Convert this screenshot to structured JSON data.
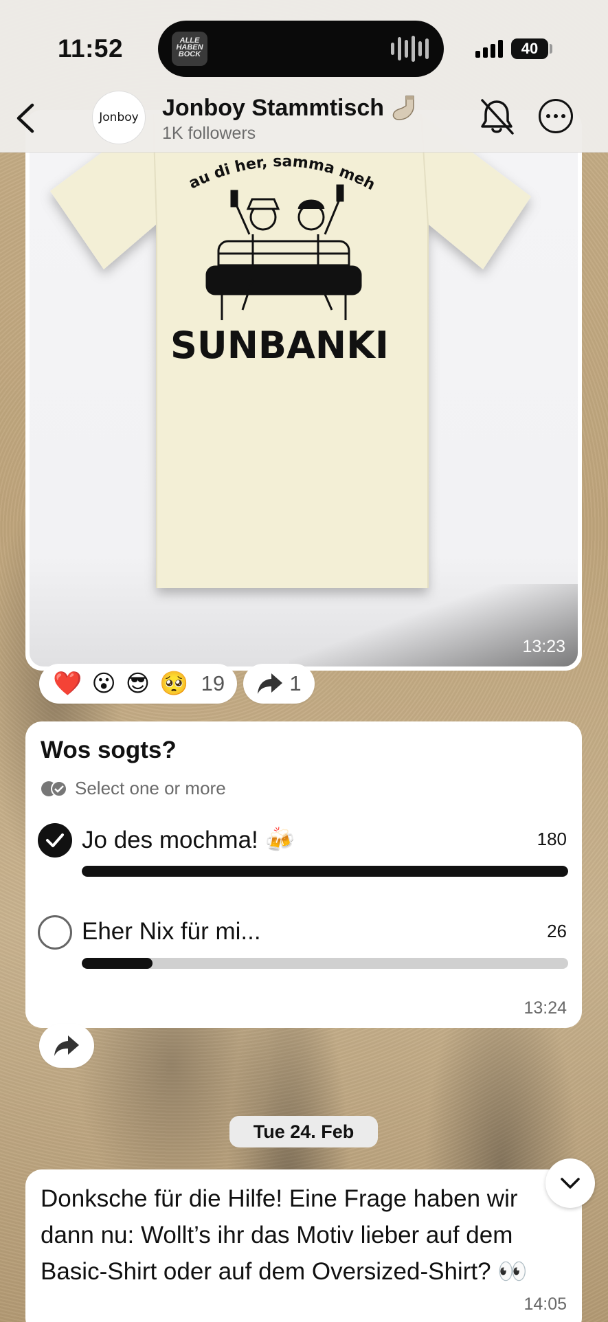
{
  "status_bar": {
    "time": "11:52",
    "island_art_text": "ALLE HABEN BOCK",
    "battery": "40"
  },
  "header": {
    "avatar_text": "Jonboy",
    "title": "Jonboy Stammtisch",
    "followers": "1K followers",
    "title_icon": "sock-icon",
    "mute_icon": "bell-slash-icon",
    "more_icon": "ellipsis-circle-icon"
  },
  "image_message": {
    "shirt_text_arc": "hau di her, samma mehr",
    "shirt_text_main": "SUNBANKI",
    "time": "13:23"
  },
  "reactions": {
    "emojis": [
      "❤️",
      "😮",
      "😎",
      "🥺"
    ],
    "count": "19",
    "share_count": "1"
  },
  "poll": {
    "question": "Wos sogts?",
    "hint": "Select one or more",
    "options": [
      {
        "label": "Jo des mochma! 🍻",
        "count": "180",
        "fraction": 1.0,
        "selected": true
      },
      {
        "label": "Eher Nix für mi...",
        "count": "26",
        "fraction": 0.145,
        "selected": false
      }
    ],
    "time": "13:24"
  },
  "date_separator": "Tue 24. Feb",
  "text_message": {
    "body": "Donksche für die Hilfe! Eine Frage haben wir dann nu: Wollt’s ihr das Motiv lieber auf dem Basic-Shirt oder auf dem Oversized-Shirt? 👀",
    "time": "14:05"
  }
}
